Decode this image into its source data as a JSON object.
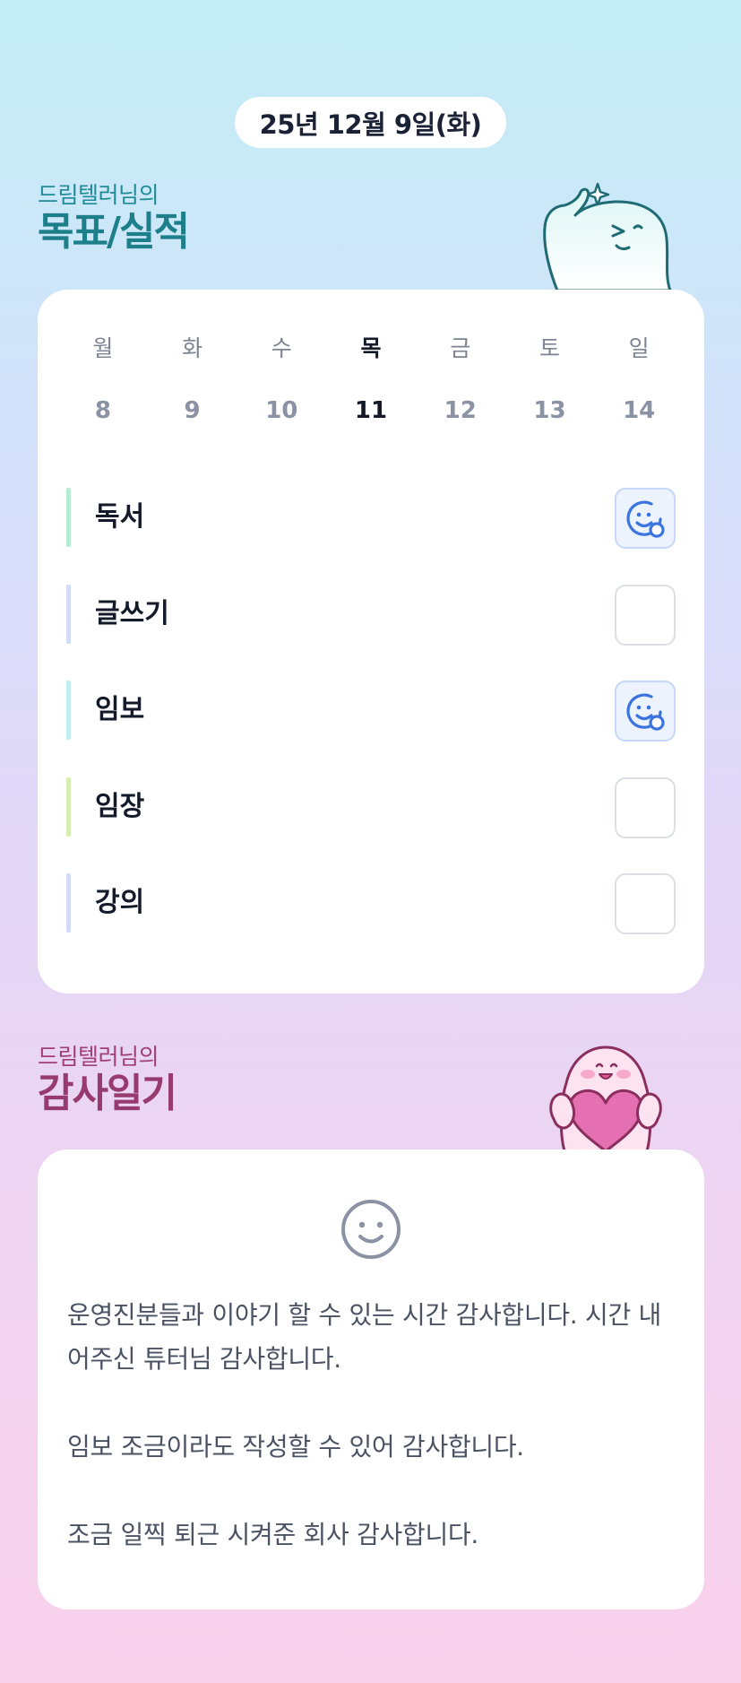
{
  "header": {
    "date_label": "25년 12월 9일(화)"
  },
  "goals_section": {
    "subtitle": "드림텔러님의",
    "title": "목표/실적"
  },
  "week": {
    "days": [
      "월",
      "화",
      "수",
      "목",
      "금",
      "토",
      "일"
    ],
    "dates": [
      "8",
      "9",
      "10",
      "11",
      "12",
      "13",
      "14"
    ],
    "active_index": 3
  },
  "goals": [
    {
      "name": "독서",
      "checked": true,
      "color": "#b7ecd4"
    },
    {
      "name": "글쓰기",
      "checked": false,
      "color": "#d2dcf8"
    },
    {
      "name": "임보",
      "checked": true,
      "color": "#c3edf2"
    },
    {
      "name": "임장",
      "checked": false,
      "color": "#d7efb5"
    },
    {
      "name": "강의",
      "checked": false,
      "color": "#d2dcf8"
    }
  ],
  "thanks_section": {
    "subtitle": "드림텔러님의",
    "title": "감사일기"
  },
  "thanks_entries": [
    "운영진분들과 이야기 할 수 있는 시간 감사합니다. 시간 내어주신 튜터님 감사합니다.",
    "임보 조금이라도 작성할 수 있어 감사합니다.",
    "조금 일찍 퇴근 시켜준 회사 감사합니다."
  ],
  "colors": {
    "accent_blue": "#3b74e0",
    "goals_title": "#1c7f89",
    "thanks_title": "#973a6d"
  },
  "icons": {
    "goal_checked": "smiley-with-badge-icon",
    "thanks_mood": "smiley-face-icon"
  }
}
